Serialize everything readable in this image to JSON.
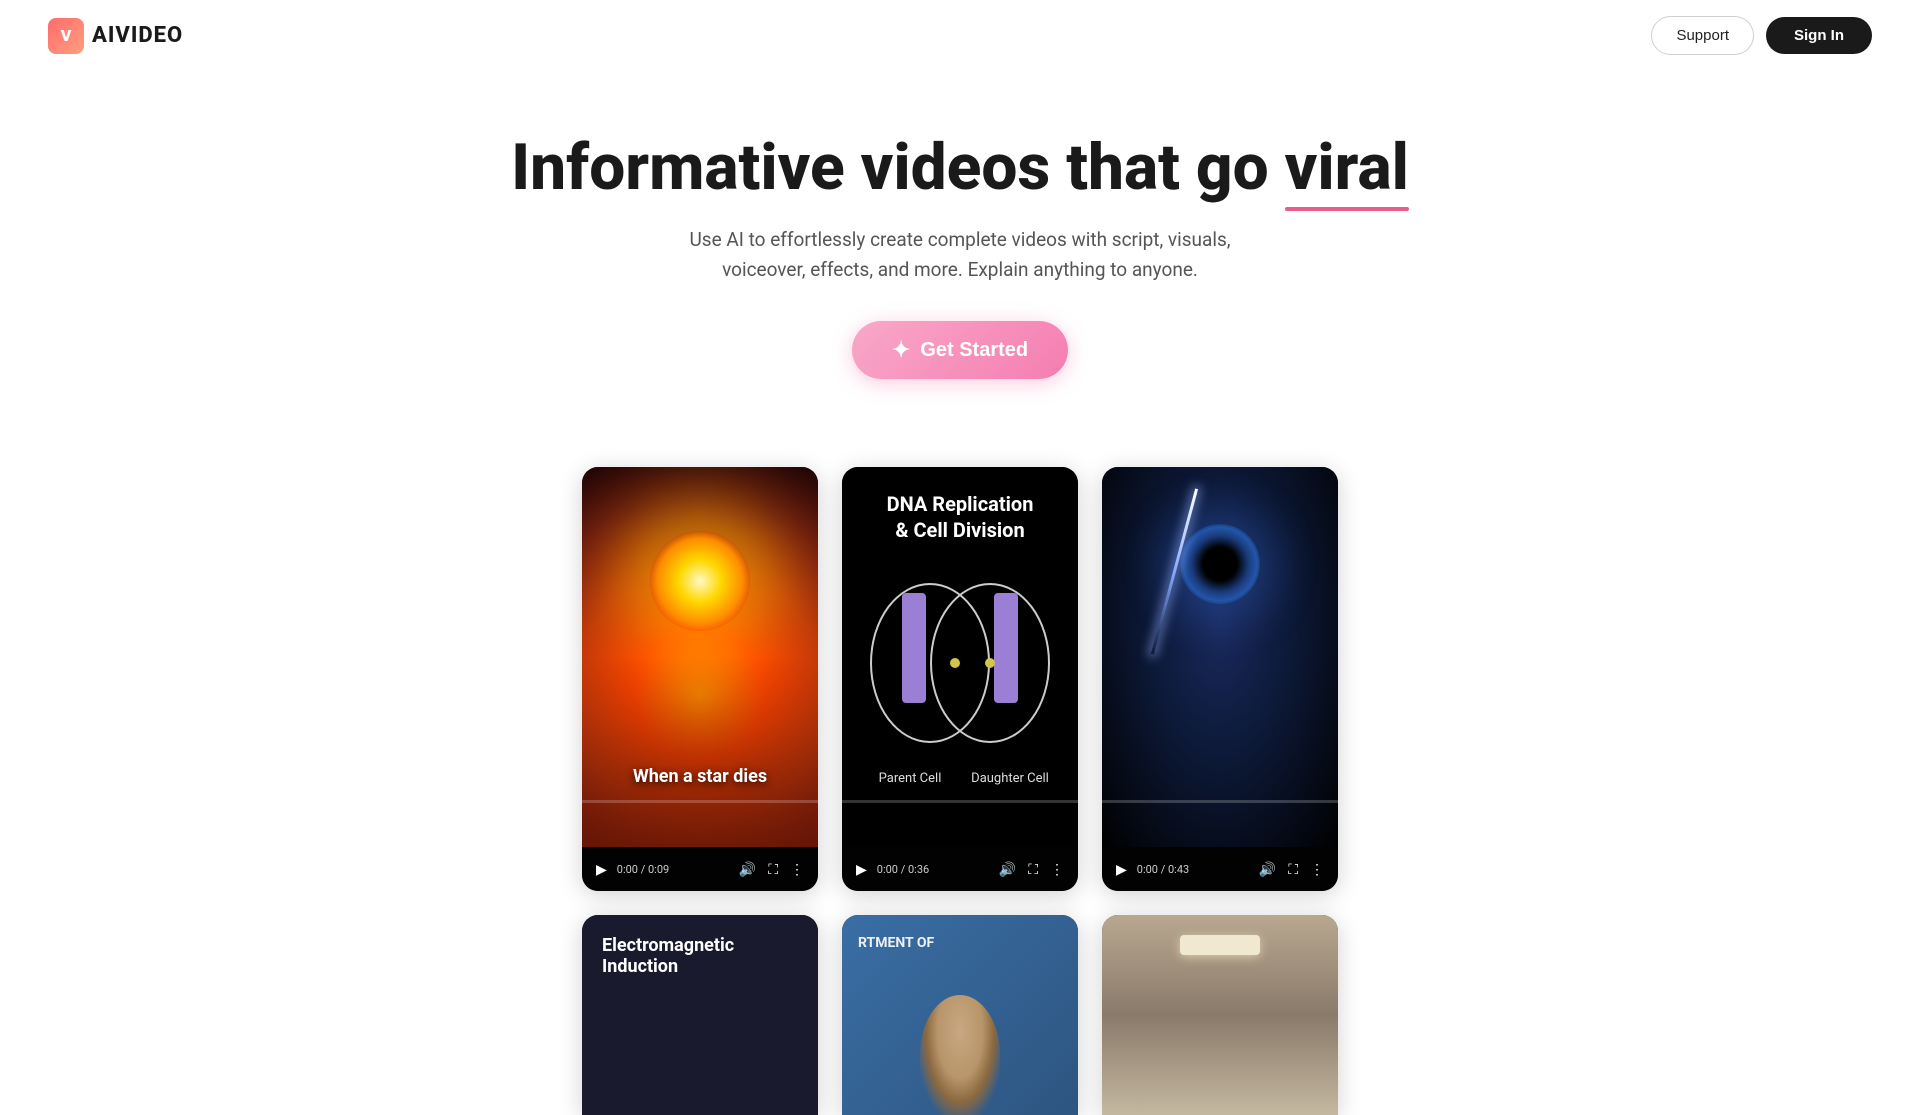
{
  "brand": {
    "logo_letter": "V",
    "name": "AIVIDEO"
  },
  "nav": {
    "support_label": "Support",
    "signin_label": "Sign In"
  },
  "hero": {
    "title_part1": "Informative videos that go ",
    "title_highlight": "viral",
    "subtitle": "Use AI to effortlessly create complete videos with script, visuals, voiceover, effects, and more. Explain anything to anyone.",
    "cta_label": "Get Started",
    "sparkle": "✦"
  },
  "videos_row1": [
    {
      "id": "star",
      "caption": "When a star dies",
      "time": "0:00 / 0:09",
      "type": "star"
    },
    {
      "id": "dna",
      "title_line1": "DNA Replication",
      "title_line2": "& Cell Division",
      "parent_label": "Parent Cell",
      "daughter_label": "Daughter Cell",
      "time": "0:00 / 0:36",
      "type": "dna"
    },
    {
      "id": "blackhole",
      "caption": "",
      "time": "0:00 / 0:43",
      "type": "blackhole"
    }
  ],
  "videos_row2": [
    {
      "id": "em",
      "title": "Electromagnetic Induction",
      "type": "em"
    },
    {
      "id": "person",
      "dept_text": "RTMENT OF",
      "type": "person"
    },
    {
      "id": "ceiling",
      "type": "ceiling"
    }
  ],
  "controls": {
    "play_icon": "▶",
    "volume_icon": "🔊",
    "fullscreen_icon": "⛶",
    "more_icon": "⋮"
  }
}
